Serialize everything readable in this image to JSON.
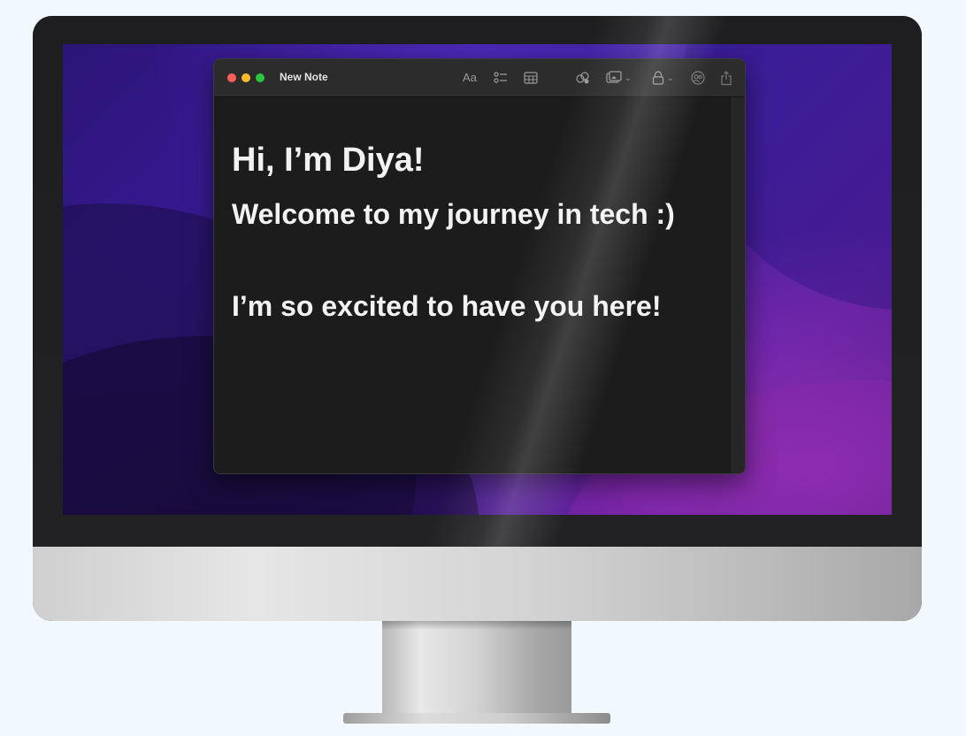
{
  "window": {
    "title": "New Note",
    "toolbar": {
      "format_label": "Aa",
      "icons": [
        "checklist-icon",
        "table-icon",
        "link-collaborate-icon",
        "media-icon",
        "lock-icon",
        "collaborate-icon",
        "share-icon"
      ]
    }
  },
  "note": {
    "title": "Hi, I’m Diya!",
    "line1": "Welcome to my journey in tech :)",
    "line2": "I’m so excited to have you here!"
  },
  "colors": {
    "page_background": "#f1f8fe",
    "window_background": "#1c1c1c",
    "titlebar": "#2c2c2c",
    "text": "#f2f2f2",
    "traffic_red": "#ff5f57",
    "traffic_yellow": "#febc2e",
    "traffic_green": "#28c840",
    "wallpaper_accent": "#4b22a8"
  }
}
